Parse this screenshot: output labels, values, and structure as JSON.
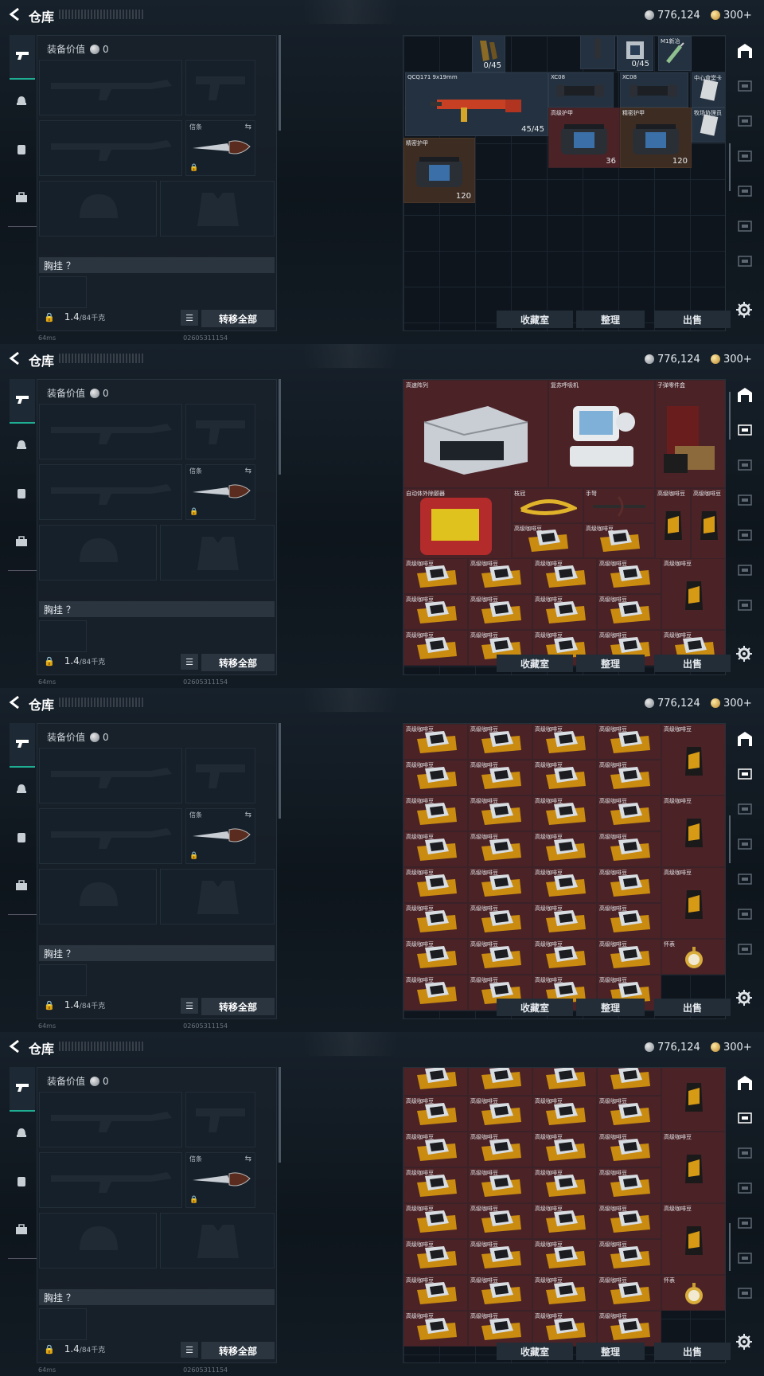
{
  "title": "仓库",
  "currency": {
    "silver": "776,124",
    "gold": "300+"
  },
  "equipment": {
    "value_label": "装备价值",
    "value": "0",
    "knife_label": "信条",
    "chest_label": "胸挂 ？",
    "weight": "1.4",
    "weight_max": "/84千克",
    "transfer_all": "转移全部"
  },
  "status": {
    "ping": "64ms",
    "uid": "02605311154"
  },
  "buttons": {
    "collection": "收藏室",
    "sort": "整理",
    "sell": "出售"
  },
  "frames": [
    {
      "cells": [
        {
          "label": "",
          "count": "0/45",
          "tone": "blue",
          "icon": "magazine"
        },
        {
          "label": "",
          "count": "",
          "tone": "blue",
          "icon": "grip"
        },
        {
          "label": "",
          "count": "0/45",
          "tone": "blue",
          "icon": "mag-box"
        },
        {
          "label": "M1新冶",
          "count": "",
          "tone": "blue",
          "icon": "syringe"
        },
        {
          "label": "QCQ171\n9x19mm",
          "count": "45/45",
          "tone": "blue",
          "icon": "smg"
        },
        {
          "label": "XC08",
          "count": "",
          "tone": "blue",
          "icon": "scope"
        },
        {
          "label": "XC08",
          "count": "",
          "tone": "blue",
          "icon": "scope"
        },
        {
          "label": "中心食堂卡",
          "count": "",
          "tone": "blue",
          "icon": "card"
        },
        {
          "label": "牧场协理员",
          "count": "",
          "tone": "blue",
          "icon": "card"
        },
        {
          "label": "高级护甲",
          "count": "36",
          "tone": "red",
          "icon": "armor"
        },
        {
          "label": "精密护甲",
          "count": "120",
          "tone": "brown",
          "icon": "armor"
        },
        {
          "label": "精密护甲",
          "count": "120",
          "tone": "brown",
          "icon": "armor"
        }
      ]
    },
    {
      "cells": [
        {
          "label": "高速阵列",
          "icon": "server"
        },
        {
          "label": "复苏呼吸机",
          "icon": "ventilator"
        },
        {
          "label": "子弹零件盒",
          "icon": "ammo-case"
        },
        {
          "label": "自动体外除颤器",
          "icon": "defib"
        },
        {
          "label": "枝冠",
          "icon": "crown"
        },
        {
          "label": "手弩",
          "icon": "crossbow"
        },
        {
          "label": "高级咖啡豆",
          "icon": "coffee"
        },
        {
          "label": "高级咖啡豆",
          "icon": "coffee"
        },
        {
          "label": "高级咖啡豆",
          "icon": "coffee"
        }
      ]
    },
    {
      "cells": [
        {
          "label": "高级咖啡豆",
          "icon": "coffee"
        },
        {
          "label": "怀表",
          "icon": "watch"
        }
      ]
    },
    {
      "cells": [
        {
          "label": "高级咖啡豆",
          "icon": "coffee"
        },
        {
          "label": "怀表",
          "icon": "watch"
        }
      ]
    }
  ]
}
